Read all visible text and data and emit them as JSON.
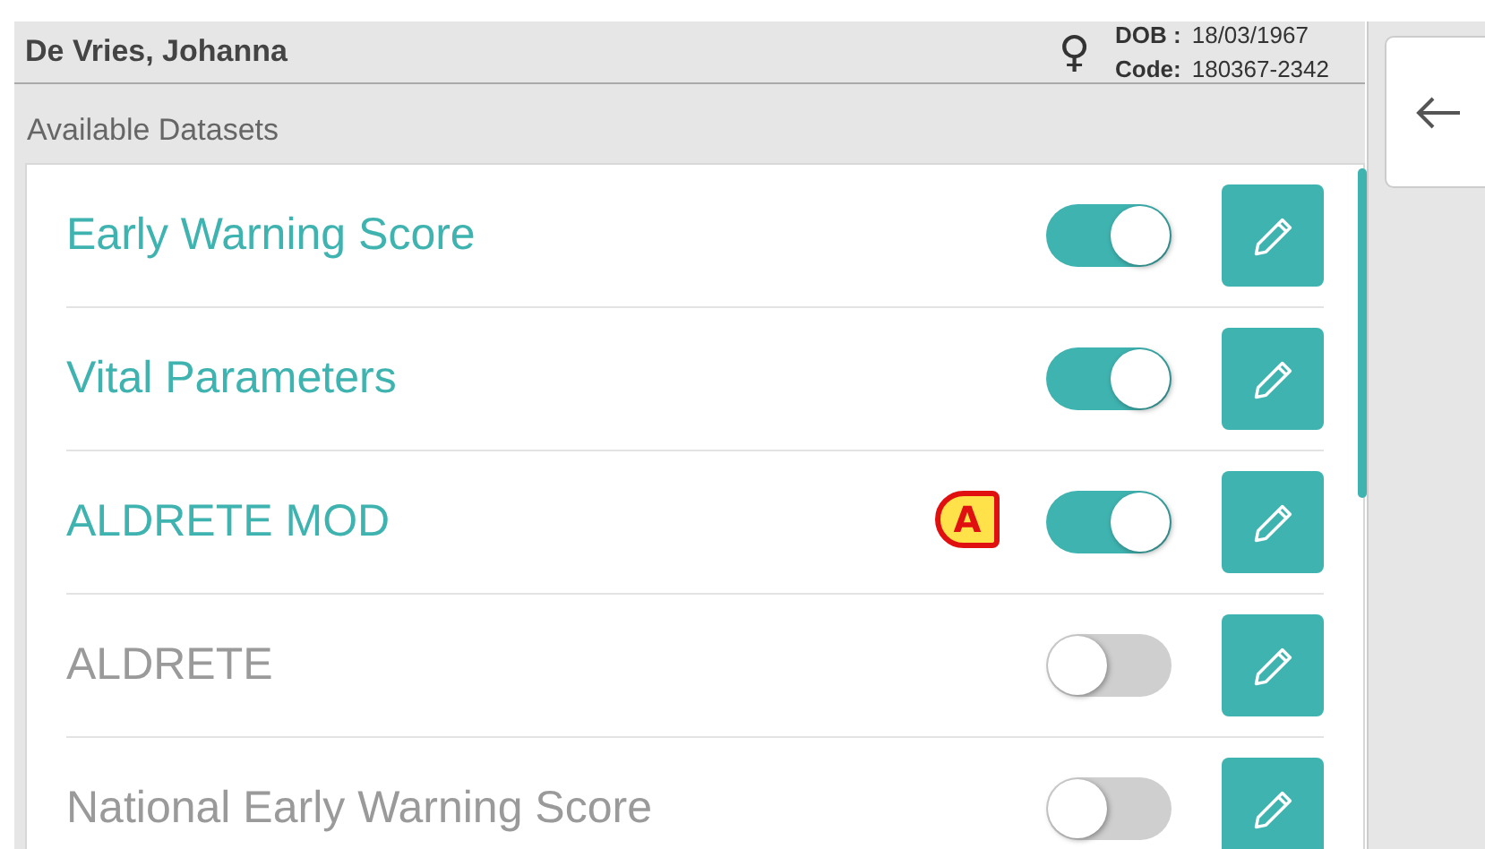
{
  "patient": {
    "name": "De Vries, Johanna",
    "sex_symbol": "♀",
    "dob_label": "DOB :",
    "dob": "18/03/1967",
    "code_label": "Code:",
    "code": "180367-2342"
  },
  "section_title": "Available Datasets",
  "datasets": [
    {
      "name": "Early Warning Score",
      "on": true
    },
    {
      "name": "Vital Parameters",
      "on": true
    },
    {
      "name": "ALDRETE MOD",
      "on": true,
      "callout": "A"
    },
    {
      "name": "ALDRETE",
      "on": false
    },
    {
      "name": "National Early Warning Score",
      "on": false
    }
  ]
}
